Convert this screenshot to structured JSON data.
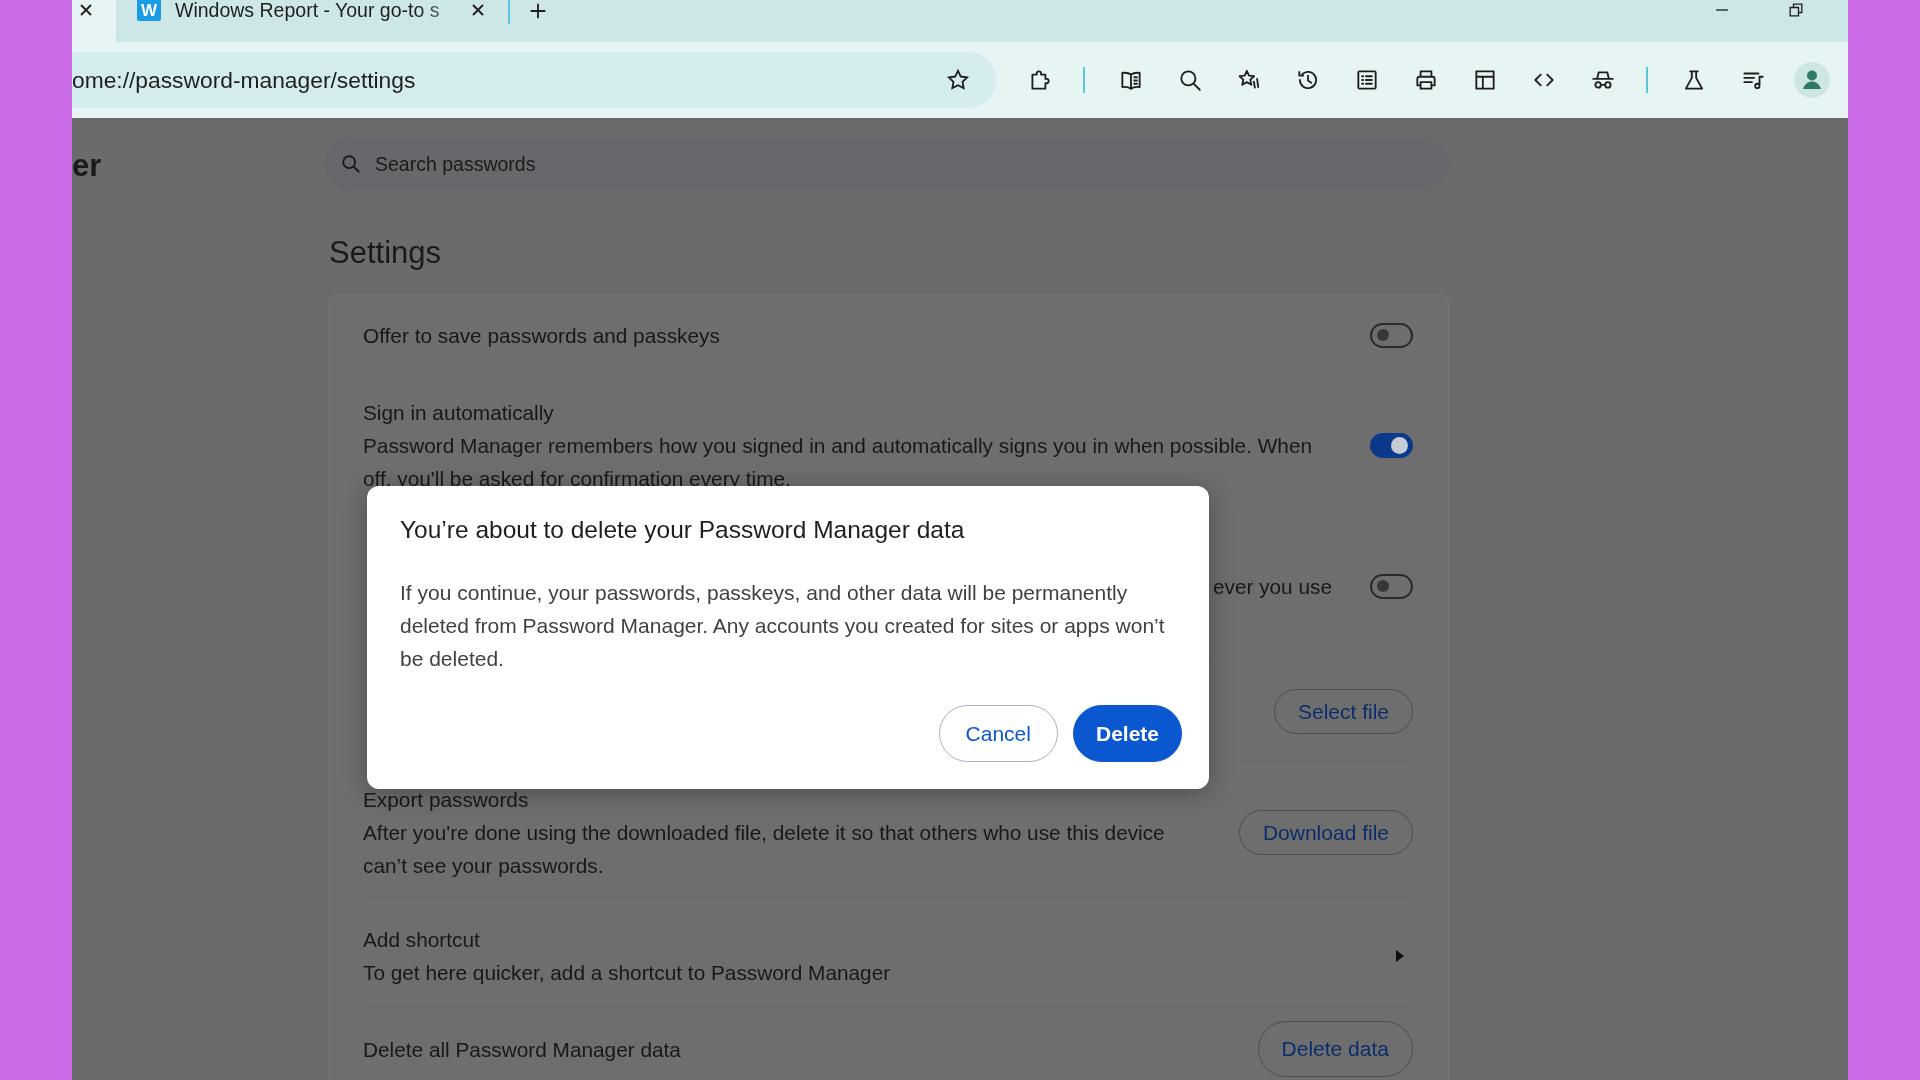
{
  "browser": {
    "tabs": [
      {
        "selected": true
      },
      {
        "favicon": "W",
        "title": "Windows Report - Your go-to s",
        "selected": false
      }
    ],
    "address_bar": {
      "url": "ome://password-manager/settings"
    }
  },
  "page": {
    "title": "er",
    "search": {
      "placeholder": "Search passwords"
    },
    "heading": "Settings",
    "rows": [
      {
        "kind": "toggle",
        "title": "Offer to save passwords and passkeys",
        "on": false
      },
      {
        "kind": "toggle",
        "title": "Sign in automatically",
        "description": "Password Manager remembers how you signed in and automatically signs you in when possible. When off, you'll be asked for confirmation every time.",
        "on": true
      },
      {
        "kind": "toggle",
        "description": "ever you use",
        "on": false
      },
      {
        "kind": "button",
        "button": "Select file"
      },
      {
        "kind": "button",
        "title": "Export passwords",
        "description": "After you're done using the downloaded file, delete it so that others who use this device can’t see your passwords.",
        "button": "Download file"
      },
      {
        "kind": "link",
        "title": "Add shortcut",
        "description": "To get here quicker, add a shortcut to Password Manager"
      },
      {
        "kind": "button",
        "title": "Delete all Password Manager data",
        "button": "Delete data"
      }
    ]
  },
  "dialog": {
    "title": "You’re about to delete your Password Manager data",
    "body": "If you continue, your passwords, passkeys, and other data will be permanently deleted from Password Manager. Any accounts you created for sites or apps won’t be deleted.",
    "buttons": [
      {
        "label": "Cancel",
        "kind": "secondary"
      },
      {
        "label": "Delete",
        "kind": "primary"
      }
    ]
  }
}
